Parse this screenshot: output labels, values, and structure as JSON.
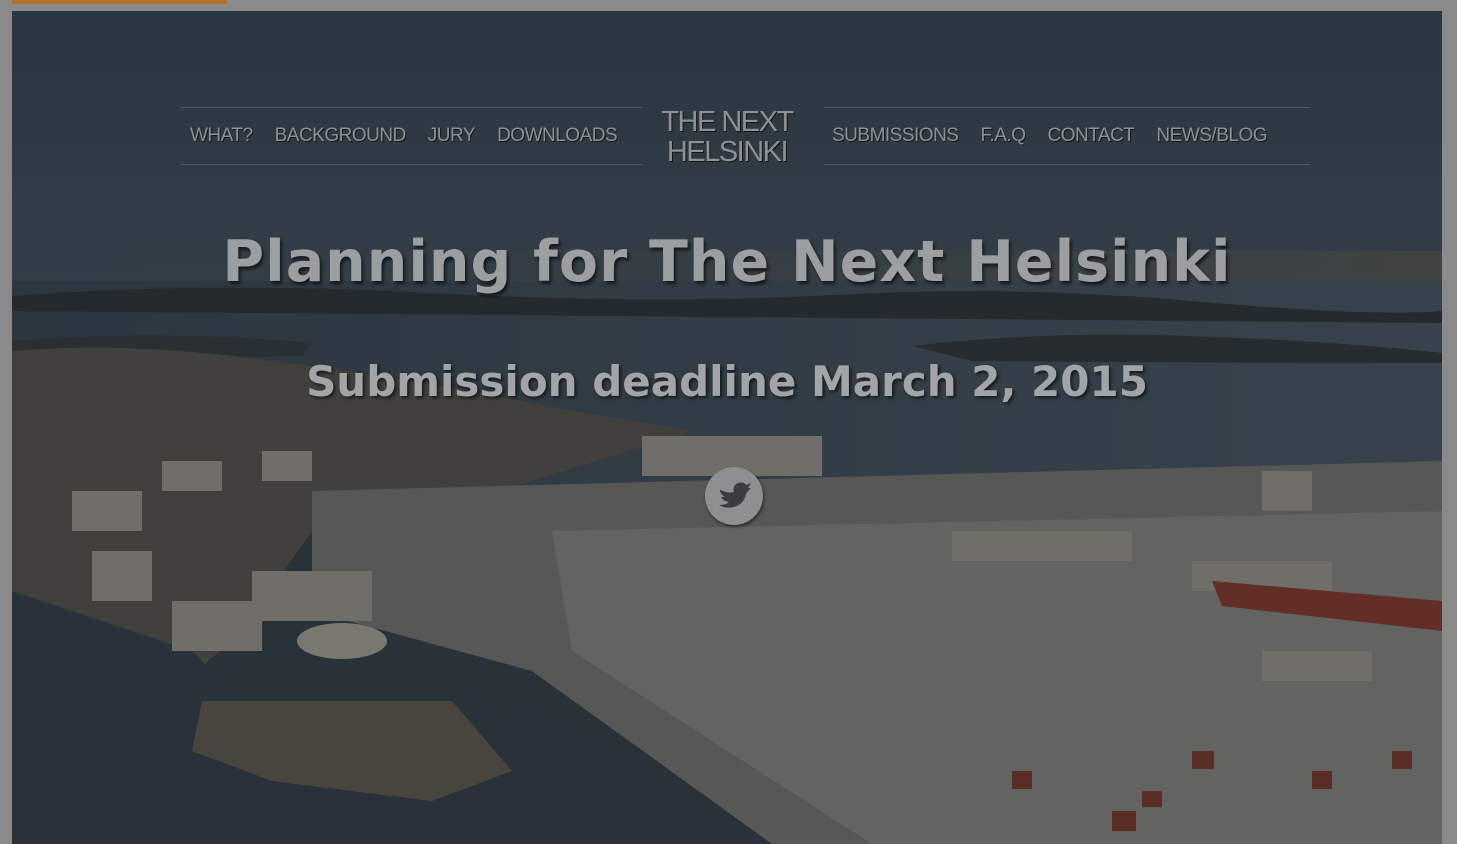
{
  "nav": {
    "left": [
      "WHAT?",
      "BACKGROUND",
      "JURY",
      "DOWNLOADS"
    ],
    "right": [
      "SUBMISSIONS",
      "F.A.Q",
      "CONTACT",
      "NEWS/BLOG"
    ]
  },
  "logo": {
    "line1": "THE NEXT",
    "line2": "HELSINKI"
  },
  "hero": {
    "headline": "Planning for The Next Helsinki",
    "subhead": "Submission deadline March 2, 2015"
  },
  "social": {
    "icon": "twitter-icon"
  },
  "colors": {
    "accent": "#b06f2b",
    "nav_text": "#8e9092"
  }
}
